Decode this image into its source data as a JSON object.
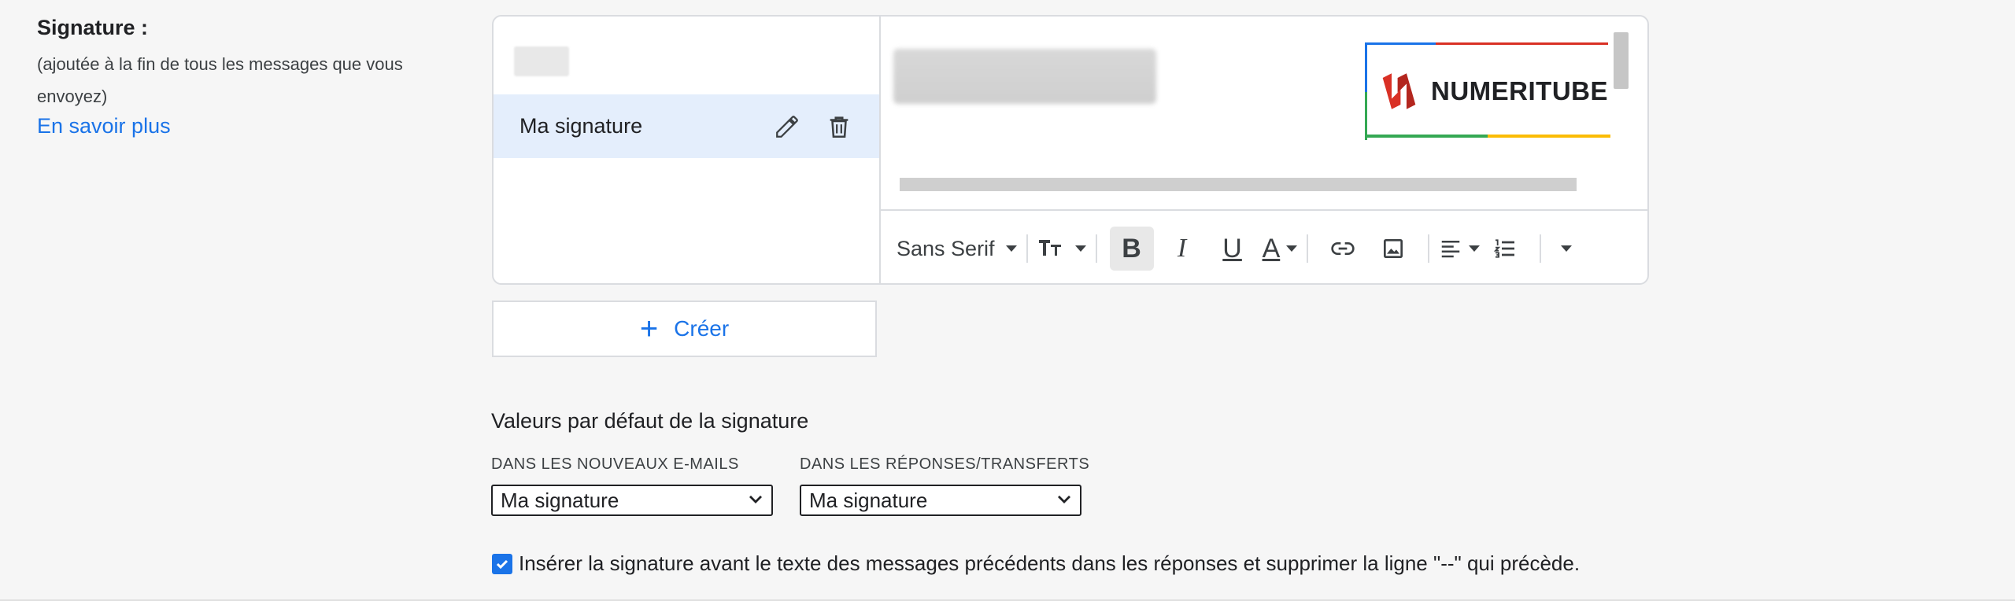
{
  "signature_section": {
    "title": "Signature :",
    "description": "(ajoutée à la fin de tous les messages que vous envoyez)",
    "learn_more": "En savoir plus"
  },
  "signatures": {
    "items": [
      {
        "label": "Ma signature",
        "selected": true
      }
    ]
  },
  "logo": {
    "text": "NUMERITUBE",
    "colors": {
      "red": "#d93025",
      "blue": "#1a73e8",
      "green": "#34a853",
      "yellow": "#fbbc04"
    }
  },
  "toolbar": {
    "font": "Sans Serif",
    "buttons": [
      "text-size-icon",
      "bold-icon",
      "italic-icon",
      "underline-icon",
      "text-color-icon",
      "link-icon",
      "image-icon",
      "align-icon",
      "numbered-list-icon",
      "more-options-icon"
    ],
    "active": "bold"
  },
  "create_button": {
    "label": "Créer"
  },
  "defaults": {
    "title": "Valeurs par défaut de la signature",
    "new_emails": {
      "label": "DANS LES NOUVEAUX E-MAILS",
      "value": "Ma signature"
    },
    "replies": {
      "label": "DANS LES RÉPONSES/TRANSFERTS",
      "value": "Ma signature"
    }
  },
  "insert_option": {
    "checked": true,
    "label": "Insérer la signature avant le texte des messages précédents dans les réponses et supprimer la ligne \"--\" qui précède."
  },
  "accent_color": "#1a73e8"
}
